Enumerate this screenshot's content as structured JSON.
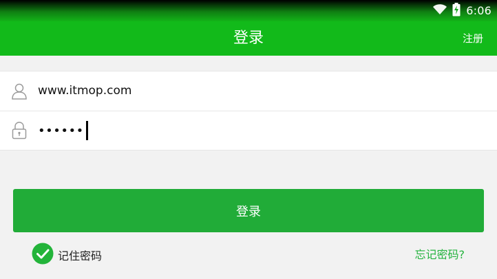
{
  "status_bar": {
    "time": "6:06",
    "icons": [
      "wifi-icon",
      "battery-charging-icon"
    ]
  },
  "header": {
    "title": "登录",
    "action_label": "注册",
    "color": "#12ba1a"
  },
  "form": {
    "username": {
      "icon": "user-icon",
      "value": "www.itmop.com"
    },
    "password": {
      "icon": "lock-icon",
      "masked_value": "••••••"
    }
  },
  "actions": {
    "login_button_label": "登录",
    "login_button_color": "#21ac38",
    "remember_password_label": "记住密码",
    "remember_password_checked": true,
    "forgot_password_label": "忘记密码?"
  }
}
